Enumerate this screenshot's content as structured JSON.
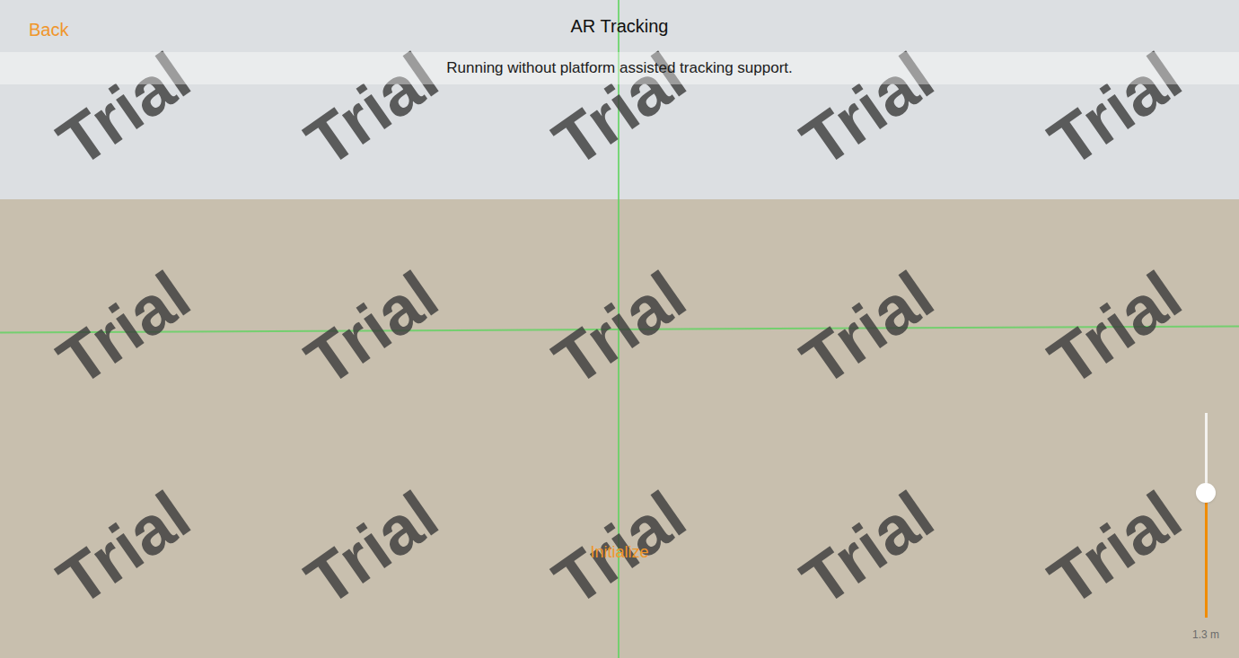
{
  "header": {
    "back": "Back",
    "title": "AR Tracking",
    "status": "Running without platform assisted tracking support."
  },
  "watermark": [
    "Trial",
    "Trial",
    "Trial",
    "Trial",
    "Trial",
    "Trial",
    "Trial",
    "Trial",
    "Trial",
    "Trial",
    "Trial",
    "Trial",
    "Trial",
    "Trial",
    "Trial"
  ],
  "initialize_button": "Initialize",
  "scale_slider": {
    "level": 0.61,
    "reading": "1.3 m"
  }
}
